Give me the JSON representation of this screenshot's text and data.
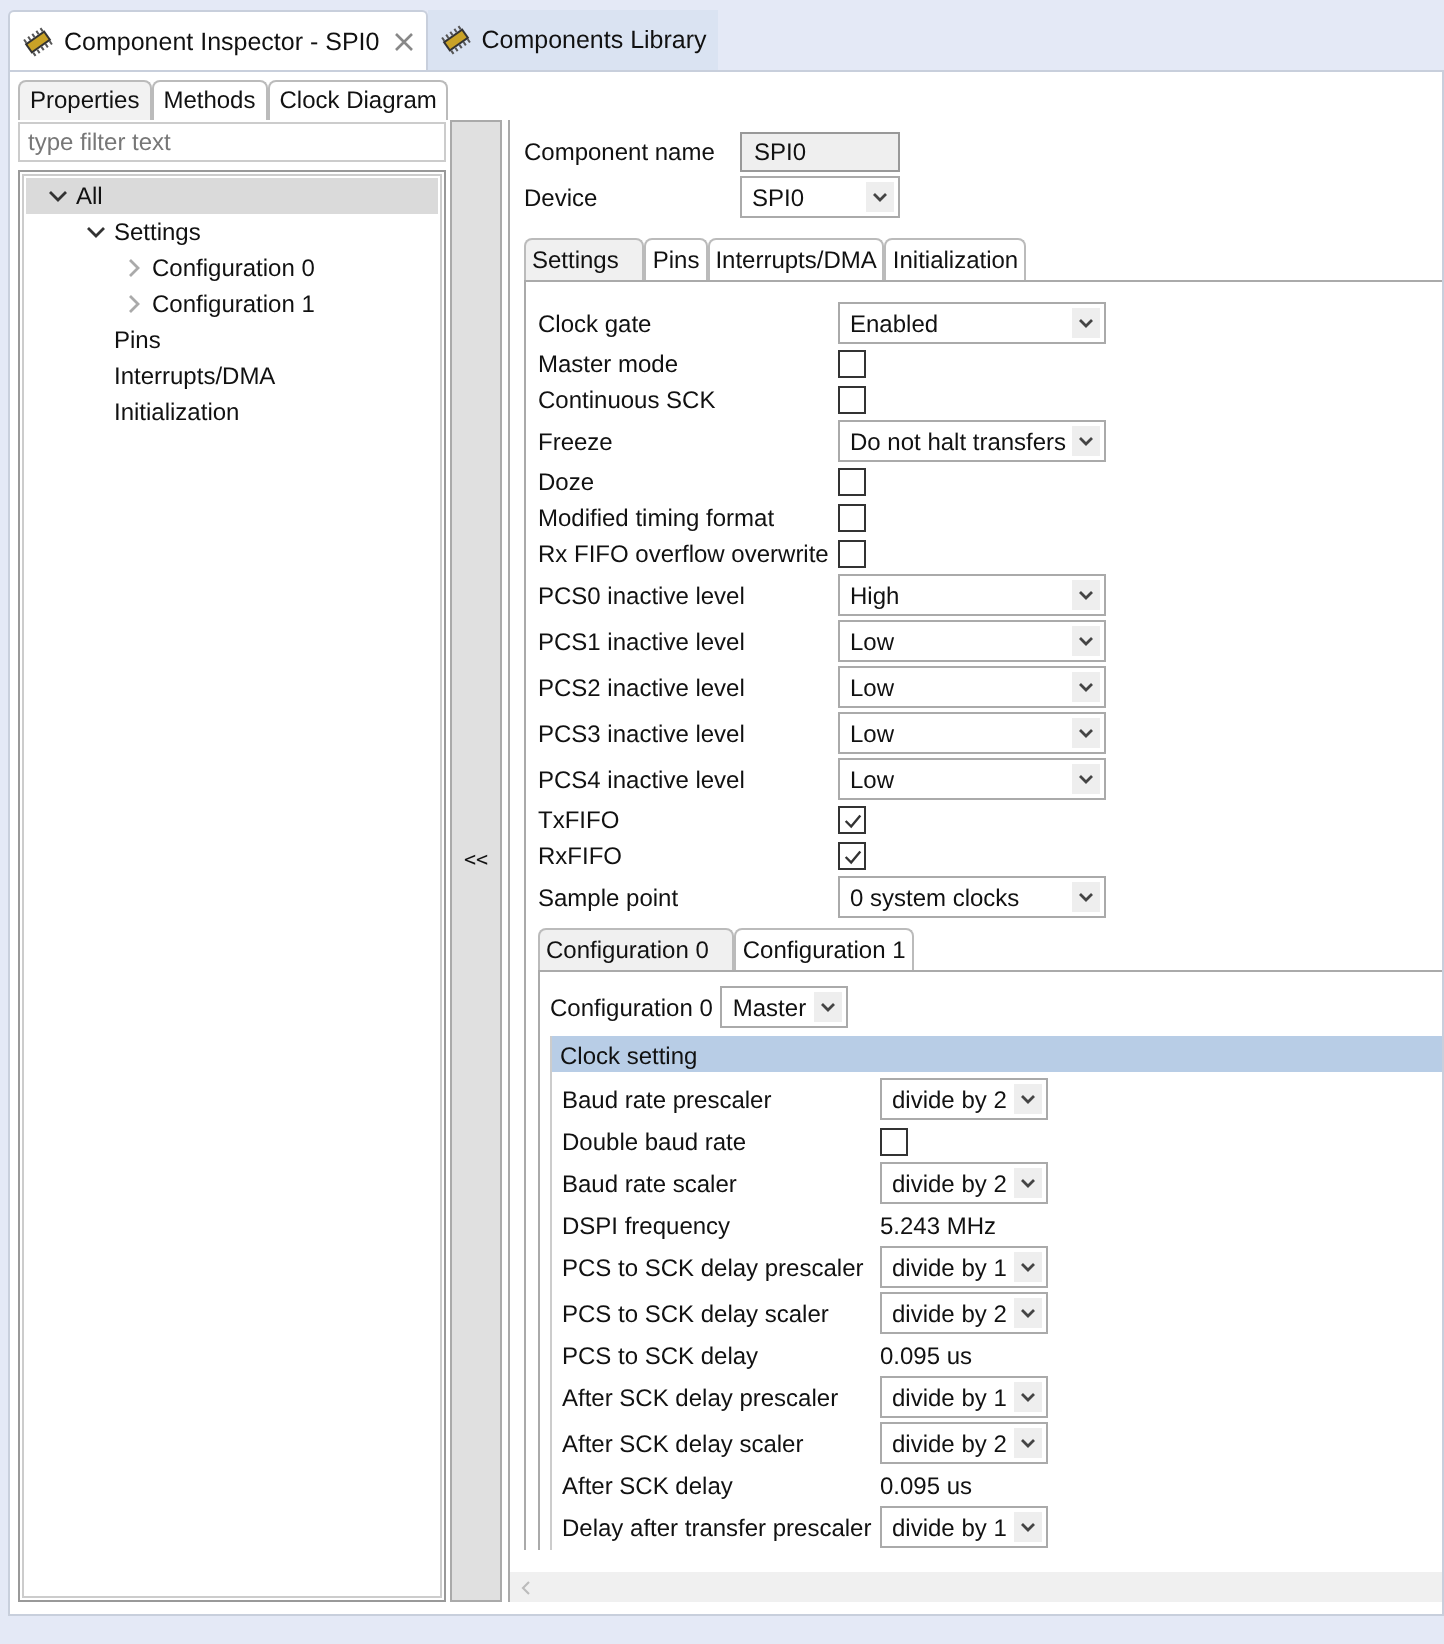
{
  "editor_tabs": [
    {
      "label": "Component Inspector - SPI0",
      "selected": true,
      "closable": true
    },
    {
      "label": "Components Library",
      "selected": false,
      "closable": false
    }
  ],
  "view_tabs": [
    {
      "label": "Properties",
      "selected": true
    },
    {
      "label": "Methods",
      "selected": false
    },
    {
      "label": "Clock Diagram",
      "selected": false
    }
  ],
  "filter": {
    "placeholder": "type filter text"
  },
  "tree": [
    {
      "label": "All",
      "selected": true,
      "expanded": true,
      "children": [
        {
          "label": "Settings",
          "selected": false,
          "expanded": true,
          "children": [
            {
              "label": "Configuration 0",
              "selected": false,
              "expanded": false
            },
            {
              "label": "Configuration 1",
              "selected": false,
              "expanded": false
            }
          ]
        },
        {
          "label": "Pins",
          "selected": false
        },
        {
          "label": "Interrupts/DMA",
          "selected": false
        },
        {
          "label": "Initialization",
          "selected": false
        }
      ]
    }
  ],
  "splitter": {
    "label": "<<"
  },
  "component_name": {
    "label": "Component name",
    "value": "SPI0"
  },
  "device": {
    "label": "Device",
    "value": "SPI0"
  },
  "settings_tabs": [
    {
      "label": "Settings",
      "selected": true
    },
    {
      "label": "Pins",
      "selected": false
    },
    {
      "label": "Interrupts/DMA",
      "selected": false
    },
    {
      "label": "Initialization",
      "selected": false
    }
  ],
  "settings": [
    {
      "kind": "select",
      "label": "Clock gate",
      "value": "Enabled"
    },
    {
      "kind": "check",
      "label": "Master mode",
      "checked": false
    },
    {
      "kind": "check",
      "label": "Continuous SCK",
      "checked": false
    },
    {
      "kind": "select",
      "label": "Freeze",
      "value": "Do not halt transfers"
    },
    {
      "kind": "check",
      "label": "Doze",
      "checked": false
    },
    {
      "kind": "check",
      "label": "Modified timing format",
      "checked": false
    },
    {
      "kind": "check",
      "label": "Rx FIFO overflow overwrite",
      "checked": false
    },
    {
      "kind": "select",
      "label": "PCS0 inactive level",
      "value": "High"
    },
    {
      "kind": "select",
      "label": "PCS1 inactive level",
      "value": "Low"
    },
    {
      "kind": "select",
      "label": "PCS2 inactive level",
      "value": "Low"
    },
    {
      "kind": "select",
      "label": "PCS3 inactive level",
      "value": "Low"
    },
    {
      "kind": "select",
      "label": "PCS4 inactive level",
      "value": "Low"
    },
    {
      "kind": "check",
      "label": "TxFIFO",
      "checked": true
    },
    {
      "kind": "check",
      "label": "RxFIFO",
      "checked": true
    },
    {
      "kind": "select",
      "label": "Sample point",
      "value": "0 system clocks"
    }
  ],
  "config_tabs": [
    {
      "label": "Configuration 0",
      "selected": true
    },
    {
      "label": "Configuration 1",
      "selected": false
    }
  ],
  "config_mode": {
    "label": "Configuration 0",
    "value": "Master"
  },
  "clock_setting": {
    "title": "Clock setting",
    "rows": [
      {
        "kind": "select",
        "label": "Baud rate prescaler",
        "value": "divide by 2"
      },
      {
        "kind": "check",
        "label": "Double baud rate",
        "checked": false
      },
      {
        "kind": "select",
        "label": "Baud rate scaler",
        "value": "divide by 2"
      },
      {
        "kind": "text",
        "label": "DSPI frequency",
        "value": "5.243 MHz"
      },
      {
        "kind": "select",
        "label": "PCS to SCK delay prescaler",
        "value": "divide by 1"
      },
      {
        "kind": "select",
        "label": "PCS to SCK delay scaler",
        "value": "divide by 2"
      },
      {
        "kind": "text",
        "label": "PCS to SCK delay",
        "value": "0.095 us"
      },
      {
        "kind": "select",
        "label": "After SCK delay prescaler",
        "value": "divide by 1"
      },
      {
        "kind": "select",
        "label": "After SCK delay scaler",
        "value": "divide by 2"
      },
      {
        "kind": "text",
        "label": "After SCK delay",
        "value": "0.095 us"
      },
      {
        "kind": "select",
        "label": "Delay after transfer prescaler",
        "value": "divide by 1"
      }
    ]
  }
}
